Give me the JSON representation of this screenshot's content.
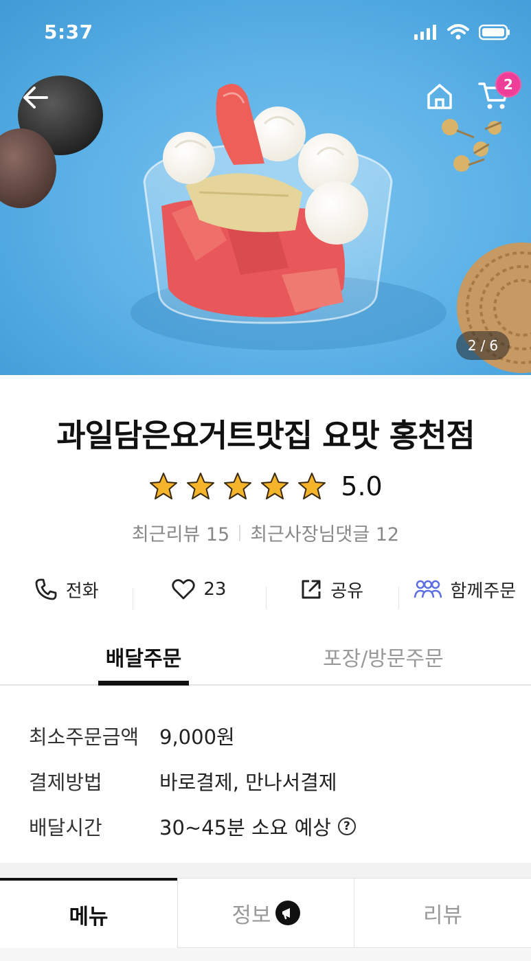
{
  "status_bar": {
    "time": "5:37"
  },
  "hero": {
    "page_current": "2",
    "page_separator": "/",
    "page_total": "6",
    "cart_count": "2",
    "back_icon": "arrow-left-icon",
    "home_icon": "home-icon",
    "cart_icon": "cart-icon"
  },
  "store": {
    "name": "과일담은요거트맛집 요맛 홍천점",
    "rating": "5.0",
    "star_count": 5,
    "recent_reviews_label": "최근리뷰",
    "recent_reviews_count": "15",
    "owner_replies_label": "최근사장님댓글",
    "owner_replies_count": "12"
  },
  "actions": {
    "call_label": "전화",
    "like_count": "23",
    "share_label": "공유",
    "group_order_label": "함께주문"
  },
  "order_tabs": {
    "delivery": "배달주문",
    "pickup": "포장/방문주문"
  },
  "delivery_info": {
    "min_order_label": "최소주문금액",
    "min_order_value": "9,000원",
    "payment_label": "결제방법",
    "payment_value": "바로결제, 만나서결제",
    "time_label": "배달시간",
    "time_value": "30~45분 소요 예상",
    "help_symbol": "?"
  },
  "bottom_tabs": {
    "menu": "메뉴",
    "info": "정보",
    "review": "리뷰"
  },
  "colors": {
    "badge": "#ef3e97",
    "star": "#f5b52a",
    "group_icon": "#5b6ee1",
    "hero_bg": "#5ab0e6"
  }
}
